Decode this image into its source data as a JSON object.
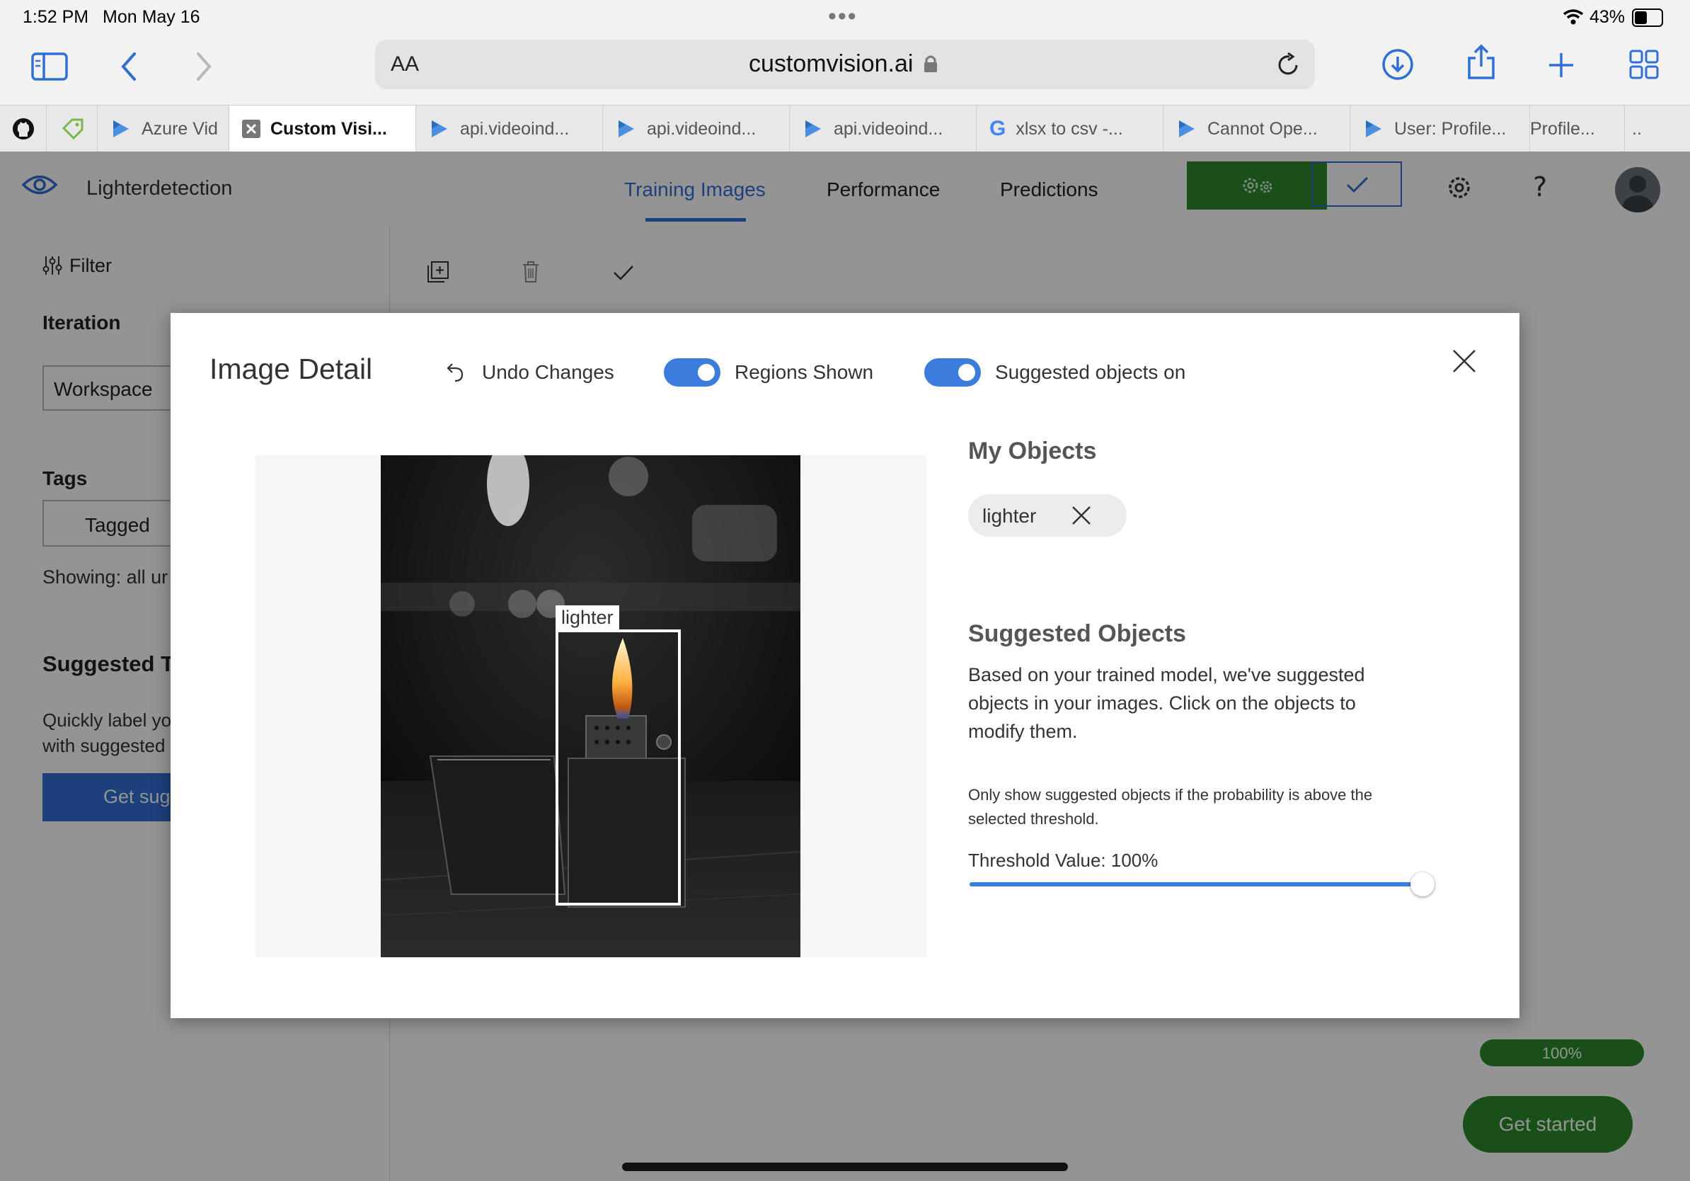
{
  "status_bar": {
    "time": "1:52 PM",
    "date": "Mon May 16",
    "battery": "43%"
  },
  "browser": {
    "address": "customvision.ai",
    "text_size_label": "AA",
    "tabs": [
      {
        "label": "Azure Vid",
        "icon": "video-indexer-icon"
      },
      {
        "label": "Custom Visi...",
        "icon": "close-tab-icon",
        "active": true
      },
      {
        "label": "api.videoind...",
        "icon": "video-indexer-icon"
      },
      {
        "label": "api.videoind...",
        "icon": "video-indexer-icon"
      },
      {
        "label": "api.videoind...",
        "icon": "video-indexer-icon"
      },
      {
        "label": "xlsx to csv -...",
        "icon": "google-icon"
      },
      {
        "label": "Cannot Ope...",
        "icon": "video-indexer-icon"
      },
      {
        "label": "User: Profile...",
        "icon": "video-indexer-icon"
      },
      {
        "label": "Profile...",
        "icon": ""
      },
      {
        "label": "..",
        "icon": ""
      }
    ]
  },
  "app": {
    "project_name": "Lighterdetection",
    "nav": [
      "Training Images",
      "Performance",
      "Predictions"
    ],
    "active_nav": "Training Images"
  },
  "sidebar": {
    "filter_label": "Filter",
    "iteration_heading": "Iteration",
    "iteration_value": "Workspace",
    "tags_heading": "Tags",
    "tags_value": "Tagged",
    "showing_text": "Showing: all ur",
    "suggested_heading": "Suggested Ta",
    "suggested_text_1": "Quickly label yo",
    "suggested_text_2": "with suggested",
    "get_suggested_button": "Get sugg"
  },
  "main": {
    "progress_label": "100%",
    "get_started_button": "Get started"
  },
  "modal": {
    "title": "Image Detail",
    "undo_label": "Undo Changes",
    "regions_label": "Regions Shown",
    "regions_on": true,
    "suggested_toggle_label": "Suggested objects on",
    "suggested_toggle_on": true,
    "region_tag": "lighter",
    "my_objects_heading": "My Objects",
    "object_chip": "lighter",
    "suggested_heading": "Suggested Objects",
    "suggested_desc_1": "Based on your trained model, we've suggested",
    "suggested_desc_2": "objects in your images. Click on the objects to",
    "suggested_desc_3": "modify them.",
    "threshold_note_1": "Only show suggested objects if the probability is above the",
    "threshold_note_2": "selected threshold.",
    "threshold_label": "Threshold Value: 100%",
    "threshold_value": 1.0
  },
  "colors": {
    "accent": "#2f6fd6",
    "green": "#2b7d2b",
    "dark_green": "#1f5e1f"
  }
}
